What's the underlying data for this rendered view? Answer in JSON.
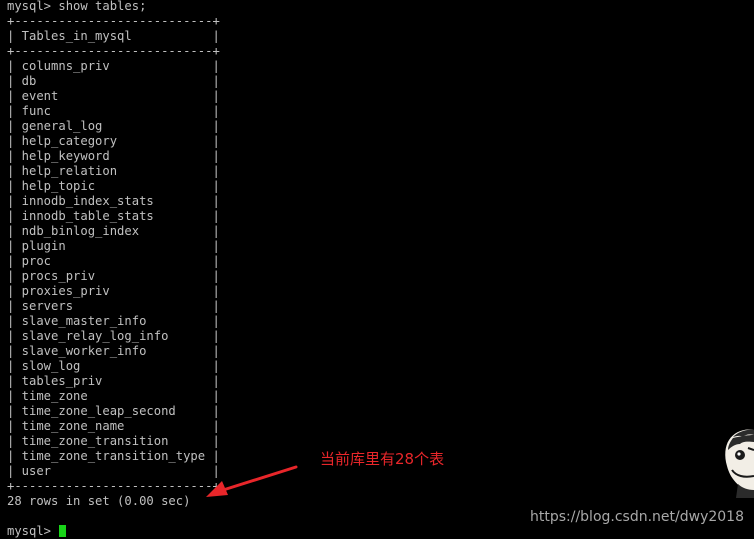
{
  "colors": {
    "background": "#000000",
    "terminal_text": "#c0c0c0",
    "cursor": "#19d419",
    "annotation": "#e8262a",
    "watermark": "#a8a8a8"
  },
  "terminal": {
    "lines": [
      "mysql> show tables;",
      "+---------------------------+",
      "| Tables_in_mysql           |",
      "+---------------------------+",
      "| columns_priv              |",
      "| db                        |",
      "| event                     |",
      "| func                      |",
      "| general_log               |",
      "| help_category             |",
      "| help_keyword              |",
      "| help_relation             |",
      "| help_topic                |",
      "| innodb_index_stats        |",
      "| innodb_table_stats        |",
      "| ndb_binlog_index          |",
      "| plugin                    |",
      "| proc                      |",
      "| procs_priv                |",
      "| proxies_priv              |",
      "| servers                   |",
      "| slave_master_info         |",
      "| slave_relay_log_info      |",
      "| slave_worker_info         |",
      "| slow_log                  |",
      "| tables_priv               |",
      "| time_zone                 |",
      "| time_zone_leap_second     |",
      "| time_zone_name            |",
      "| time_zone_transition      |",
      "| time_zone_transition_type |",
      "| user                      |",
      "+---------------------------+",
      "28 rows in set (0.00 sec)",
      "",
      "mysql> "
    ]
  },
  "annotation": {
    "text": "当前库里有28个表",
    "arrow_icon": "red-arrow-icon"
  },
  "watermark": {
    "text": "https://blog.csdn.net/dwy2018"
  },
  "sticker": {
    "icon": "cartoon-face-icon"
  }
}
